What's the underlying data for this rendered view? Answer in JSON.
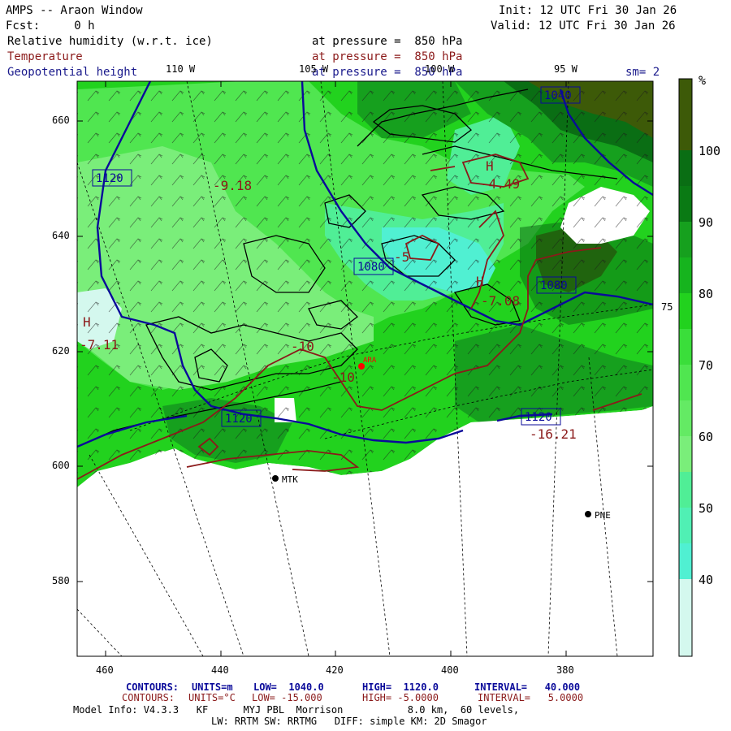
{
  "header": {
    "title": "AMPS -- Araon Window",
    "init": "Init: 12 UTC Fri 30 Jan 26",
    "fcst": "Fcst:     0 h",
    "valid": "Valid: 12 UTC Fri 30 Jan 26",
    "line_rh": "Relative humidity (w.r.t. ice)",
    "line_temp": "Temperature",
    "line_geo": "Geopotential height",
    "pressure_rh": "at pressure =  850 hPa",
    "pressure_temp": "at pressure =  850 hPa",
    "pressure_geo": "at pressure =  850 hPa",
    "smoothing": "sm= 2"
  },
  "map": {
    "lon_labels": [
      "110 W",
      "105 W",
      "100 W",
      "95 W"
    ],
    "lat_label": "75 S",
    "y_ticks": [
      "660",
      "640",
      "620",
      "600",
      "580"
    ],
    "x_ticks": [
      "460",
      "440",
      "420",
      "400",
      "380"
    ],
    "height_labels": [
      "1040",
      "1120",
      "1080",
      "1080",
      "1120",
      "1120"
    ],
    "temp_labels": [
      "-9.18",
      "-4.49",
      "-5",
      "-10",
      "-10",
      "-7.08",
      "-7.11",
      "-16.21"
    ],
    "highs": [
      "H",
      "H",
      "H"
    ],
    "stations": [
      "MTK",
      "PNE",
      "ARA"
    ],
    "colors": {
      "height": "#0a0a9a",
      "temp": "#8b1a1a",
      "coast": "#000000",
      "station": "#ff0000"
    }
  },
  "colorbar": {
    "unit": "%",
    "labels": [
      "100",
      "90",
      "80",
      "70",
      "60",
      "50",
      "40"
    ],
    "colors": [
      "#3d5a08",
      "#0a6e14",
      "#16a01e",
      "#22d21e",
      "#50e650",
      "#7aee7a",
      "#50ee96",
      "#50f0d2",
      "#d4f8ee"
    ]
  },
  "footer": {
    "contours_label_1": "CONTOURS:",
    "units_1": "UNITS=m",
    "low_1": "LOW=  1040.0",
    "high_1": "HIGH=  1120.0",
    "interval_1": "INTERVAL=   40.000",
    "contours_label_2": "CONTOURS:",
    "units_2": "UNITS=°C",
    "low_2": "LOW= -15.000",
    "high_2": "HIGH= -5.0000",
    "interval_2": "INTERVAL=   5.0000",
    "model_info": "Model Info: V4.3.3   KF      MYJ PBL  Morrison           8.0 km,  60 levels,",
    "model_info_2": "LW: RRTM SW: RRTMG   DIFF: simple KM: 2D Smagor"
  }
}
